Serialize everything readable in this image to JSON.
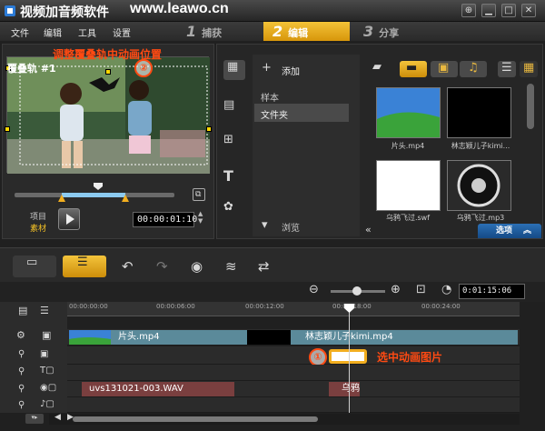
{
  "title_bar": {
    "app_title": "视频加音频软件",
    "watermark": "www.leawo.cn"
  },
  "menu": {
    "items": [
      "文件",
      "编辑",
      "工具",
      "设置"
    ]
  },
  "steps": [
    {
      "num": "1",
      "label": "捕获"
    },
    {
      "num": "2",
      "label": "编辑"
    },
    {
      "num": "3",
      "label": "分享"
    }
  ],
  "preview": {
    "annotation": "调整覆叠轨中动画位置",
    "overlay_text": "覆叠轨 #1",
    "marker": "②",
    "mode_label_project": "项目",
    "mode_label_clip": "素材",
    "timecode": "00:00:01:10"
  },
  "library": {
    "add_label": "添加",
    "folders": [
      "样本",
      "文件夹"
    ],
    "selected_folder": "文件夹",
    "browse_label": "浏览",
    "thumbnails": [
      {
        "caption": "片头.mp4"
      },
      {
        "caption": "林志颖儿子kimi..."
      },
      {
        "caption": "乌鸦飞过.swf"
      },
      {
        "caption": "乌鸦飞过.mp3"
      }
    ],
    "options_label": "选项"
  },
  "timeline": {
    "timecode": "0:01:15:06",
    "ruler_ticks": [
      "00:00:00:00",
      "00:00:06:00",
      "00:00:12:00",
      "00:00:18:00",
      "00:00:24:00"
    ],
    "video_clips": [
      "片头.mp4",
      "林志颖儿子kimi.mp4"
    ],
    "audio_clips": [
      "uvs131021-003.WAV",
      "乌鸦"
    ],
    "annotation": "选中动画图片",
    "marker": "①"
  },
  "colors": {
    "accent": "#f2ae1f",
    "annotation": "#ff4a12",
    "options": "#1d5a9c"
  }
}
